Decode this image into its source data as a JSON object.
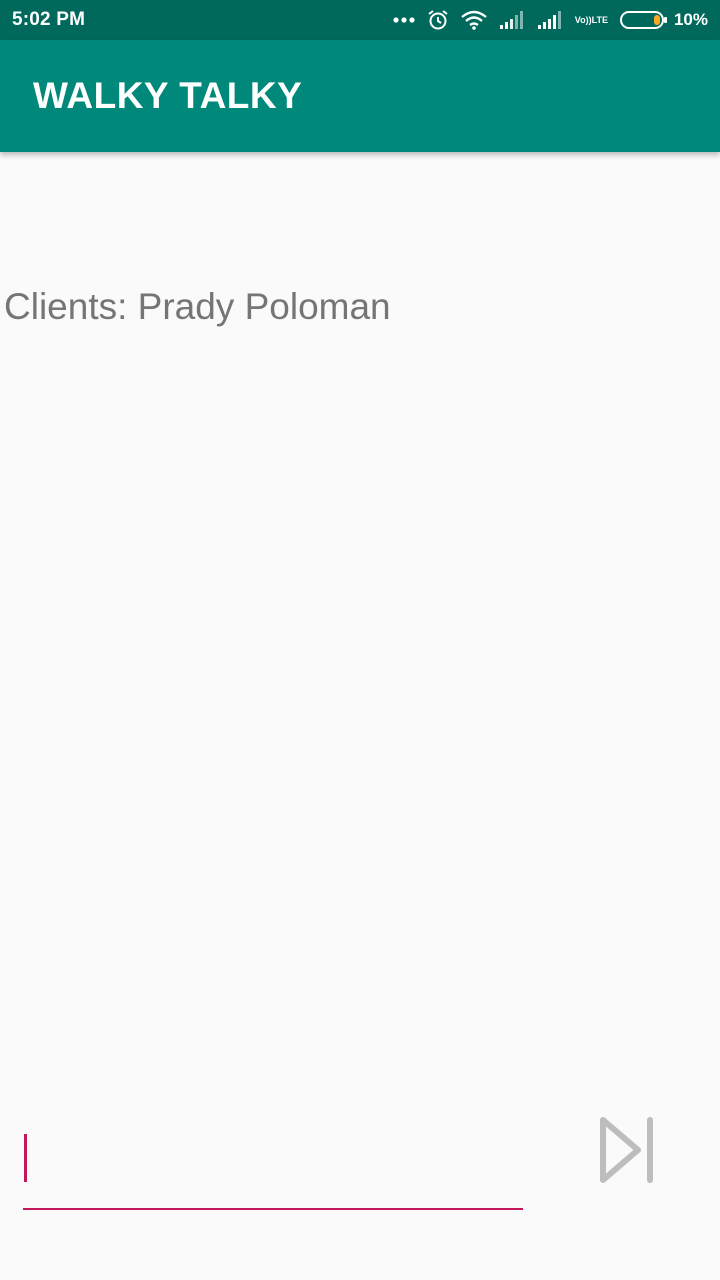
{
  "status_bar": {
    "time": "5:02 PM",
    "volte_top": "Vo))",
    "volte_bottom": "LTE",
    "battery_percent": "10%",
    "icons": [
      "more-dots-icon",
      "alarm-icon",
      "wifi-icon",
      "signal-icon",
      "signal-icon",
      "volte-icon",
      "battery-icon"
    ],
    "battery_level": 0.1
  },
  "app_bar": {
    "title": "WALKY TALKY",
    "color": "#00897b",
    "status_color": "#00695c"
  },
  "main": {
    "clients_text": "Clients: Prady Poloman"
  },
  "composer": {
    "input_value": "",
    "accent_color": "#c2185b",
    "send_icon": "send-next-icon"
  }
}
